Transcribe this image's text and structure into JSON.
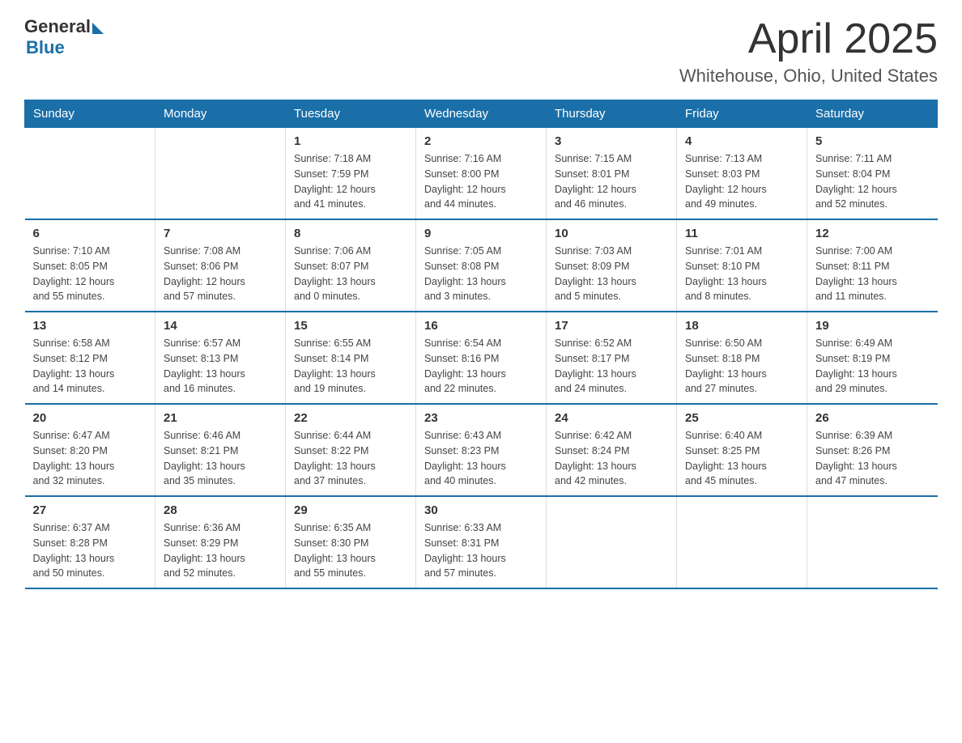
{
  "logo": {
    "general": "General",
    "blue": "Blue"
  },
  "title": "April 2025",
  "subtitle": "Whitehouse, Ohio, United States",
  "days_of_week": [
    "Sunday",
    "Monday",
    "Tuesday",
    "Wednesday",
    "Thursday",
    "Friday",
    "Saturday"
  ],
  "weeks": [
    [
      {
        "day": "",
        "info": ""
      },
      {
        "day": "",
        "info": ""
      },
      {
        "day": "1",
        "info": "Sunrise: 7:18 AM\nSunset: 7:59 PM\nDaylight: 12 hours\nand 41 minutes."
      },
      {
        "day": "2",
        "info": "Sunrise: 7:16 AM\nSunset: 8:00 PM\nDaylight: 12 hours\nand 44 minutes."
      },
      {
        "day": "3",
        "info": "Sunrise: 7:15 AM\nSunset: 8:01 PM\nDaylight: 12 hours\nand 46 minutes."
      },
      {
        "day": "4",
        "info": "Sunrise: 7:13 AM\nSunset: 8:03 PM\nDaylight: 12 hours\nand 49 minutes."
      },
      {
        "day": "5",
        "info": "Sunrise: 7:11 AM\nSunset: 8:04 PM\nDaylight: 12 hours\nand 52 minutes."
      }
    ],
    [
      {
        "day": "6",
        "info": "Sunrise: 7:10 AM\nSunset: 8:05 PM\nDaylight: 12 hours\nand 55 minutes."
      },
      {
        "day": "7",
        "info": "Sunrise: 7:08 AM\nSunset: 8:06 PM\nDaylight: 12 hours\nand 57 minutes."
      },
      {
        "day": "8",
        "info": "Sunrise: 7:06 AM\nSunset: 8:07 PM\nDaylight: 13 hours\nand 0 minutes."
      },
      {
        "day": "9",
        "info": "Sunrise: 7:05 AM\nSunset: 8:08 PM\nDaylight: 13 hours\nand 3 minutes."
      },
      {
        "day": "10",
        "info": "Sunrise: 7:03 AM\nSunset: 8:09 PM\nDaylight: 13 hours\nand 5 minutes."
      },
      {
        "day": "11",
        "info": "Sunrise: 7:01 AM\nSunset: 8:10 PM\nDaylight: 13 hours\nand 8 minutes."
      },
      {
        "day": "12",
        "info": "Sunrise: 7:00 AM\nSunset: 8:11 PM\nDaylight: 13 hours\nand 11 minutes."
      }
    ],
    [
      {
        "day": "13",
        "info": "Sunrise: 6:58 AM\nSunset: 8:12 PM\nDaylight: 13 hours\nand 14 minutes."
      },
      {
        "day": "14",
        "info": "Sunrise: 6:57 AM\nSunset: 8:13 PM\nDaylight: 13 hours\nand 16 minutes."
      },
      {
        "day": "15",
        "info": "Sunrise: 6:55 AM\nSunset: 8:14 PM\nDaylight: 13 hours\nand 19 minutes."
      },
      {
        "day": "16",
        "info": "Sunrise: 6:54 AM\nSunset: 8:16 PM\nDaylight: 13 hours\nand 22 minutes."
      },
      {
        "day": "17",
        "info": "Sunrise: 6:52 AM\nSunset: 8:17 PM\nDaylight: 13 hours\nand 24 minutes."
      },
      {
        "day": "18",
        "info": "Sunrise: 6:50 AM\nSunset: 8:18 PM\nDaylight: 13 hours\nand 27 minutes."
      },
      {
        "day": "19",
        "info": "Sunrise: 6:49 AM\nSunset: 8:19 PM\nDaylight: 13 hours\nand 29 minutes."
      }
    ],
    [
      {
        "day": "20",
        "info": "Sunrise: 6:47 AM\nSunset: 8:20 PM\nDaylight: 13 hours\nand 32 minutes."
      },
      {
        "day": "21",
        "info": "Sunrise: 6:46 AM\nSunset: 8:21 PM\nDaylight: 13 hours\nand 35 minutes."
      },
      {
        "day": "22",
        "info": "Sunrise: 6:44 AM\nSunset: 8:22 PM\nDaylight: 13 hours\nand 37 minutes."
      },
      {
        "day": "23",
        "info": "Sunrise: 6:43 AM\nSunset: 8:23 PM\nDaylight: 13 hours\nand 40 minutes."
      },
      {
        "day": "24",
        "info": "Sunrise: 6:42 AM\nSunset: 8:24 PM\nDaylight: 13 hours\nand 42 minutes."
      },
      {
        "day": "25",
        "info": "Sunrise: 6:40 AM\nSunset: 8:25 PM\nDaylight: 13 hours\nand 45 minutes."
      },
      {
        "day": "26",
        "info": "Sunrise: 6:39 AM\nSunset: 8:26 PM\nDaylight: 13 hours\nand 47 minutes."
      }
    ],
    [
      {
        "day": "27",
        "info": "Sunrise: 6:37 AM\nSunset: 8:28 PM\nDaylight: 13 hours\nand 50 minutes."
      },
      {
        "day": "28",
        "info": "Sunrise: 6:36 AM\nSunset: 8:29 PM\nDaylight: 13 hours\nand 52 minutes."
      },
      {
        "day": "29",
        "info": "Sunrise: 6:35 AM\nSunset: 8:30 PM\nDaylight: 13 hours\nand 55 minutes."
      },
      {
        "day": "30",
        "info": "Sunrise: 6:33 AM\nSunset: 8:31 PM\nDaylight: 13 hours\nand 57 minutes."
      },
      {
        "day": "",
        "info": ""
      },
      {
        "day": "",
        "info": ""
      },
      {
        "day": "",
        "info": ""
      }
    ]
  ]
}
